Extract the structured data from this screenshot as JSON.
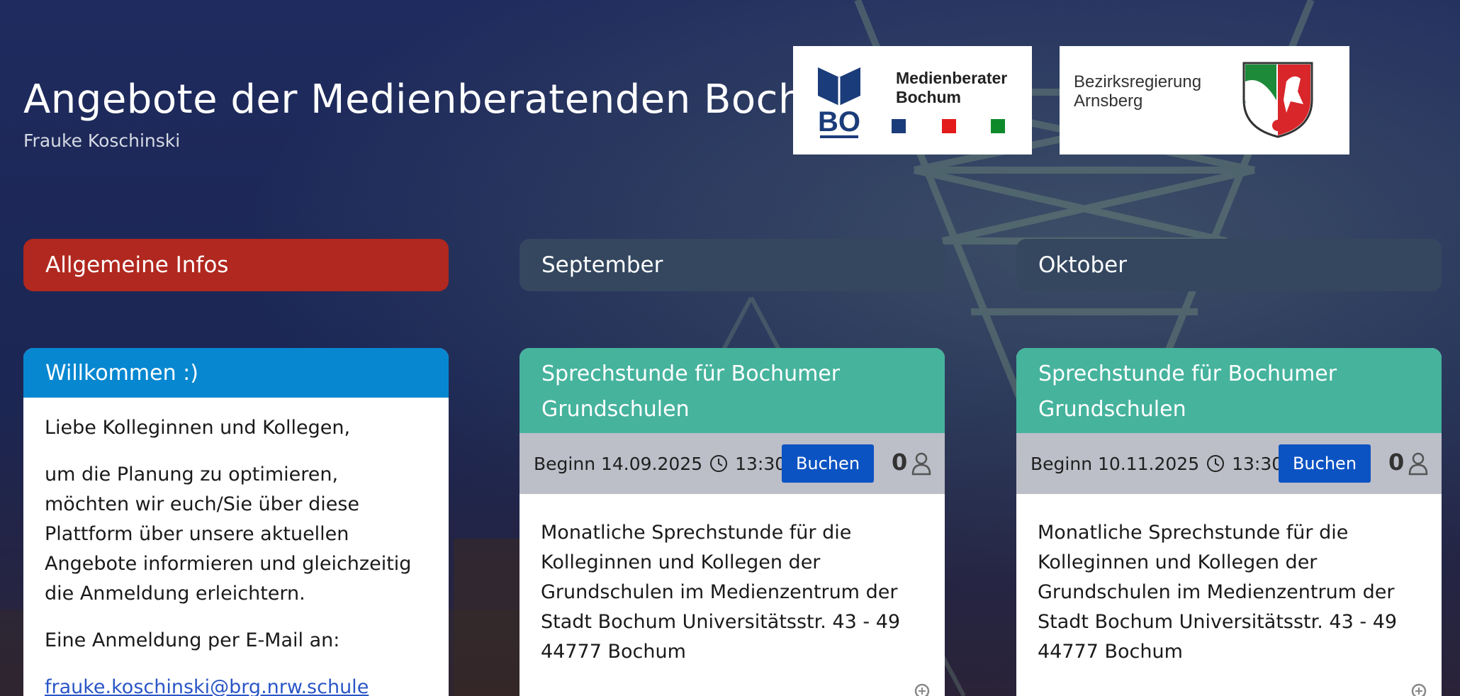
{
  "header": {
    "title": "Angebote der Medienberatenden Bochum",
    "subtitle": "Frauke Koschinski"
  },
  "logos": {
    "medienberater": {
      "mark": "BO",
      "line1": "Medienberater",
      "line2": "Bochum",
      "squares": [
        "#1b3c7a",
        "#e31b1b",
        "#0e8a2b"
      ]
    },
    "bezirksregierung": {
      "line1": "Bezirksregierung",
      "line2": "Arnsberg"
    }
  },
  "columns": [
    {
      "label": "Allgemeine Infos",
      "color": "#b0281f"
    },
    {
      "label": "September",
      "color": "#34475f"
    },
    {
      "label": "Oktober",
      "color": "#34475f"
    }
  ],
  "welcome_card": {
    "title": "Willkommen :)",
    "paragraphs": [
      "Liebe Kolleginnen und Kollegen,",
      "um die Planung zu optimieren, möchten wir euch/Sie über diese Plattform über unsere aktuellen Angebote informieren und gleichzeitig die Anmeldung erleichtern.",
      "Eine Anmeldung per E-Mail an:"
    ],
    "email": "frauke.koschinski@brg.nrw.schule"
  },
  "events": [
    {
      "title": "Sprechstunde für Bochumer Grundschulen",
      "begin": "Beginn 14.09.2025",
      "time": "13:30",
      "button": "Buchen",
      "count": "0",
      "description": "Monatliche Sprechstunde für die Kolleginnen und Kollegen der Grundschulen im Medienzentrum der Stadt Bochum Universitätsstr. 43 - 49 44777 Bochum"
    },
    {
      "title": "Sprechstunde für Bochumer Grundschulen",
      "begin": "Beginn 10.11.2025",
      "time": "13:30",
      "button": "Buchen",
      "count": "0",
      "description": "Monatliche Sprechstunde für die Kolleginnen und Kollegen der Grundschulen im Medienzentrum der Stadt Bochum Universitätsstr. 43 - 49 44777 Bochum"
    }
  ],
  "icons": {
    "clock": "clock-icon",
    "user": "user-icon",
    "zoom": "zoom-in-icon"
  },
  "colors": {
    "event_header": "#46b39d",
    "welcome_header": "#0787d0",
    "book_button": "#0b53c3",
    "event_bar": "#bcbec8"
  }
}
